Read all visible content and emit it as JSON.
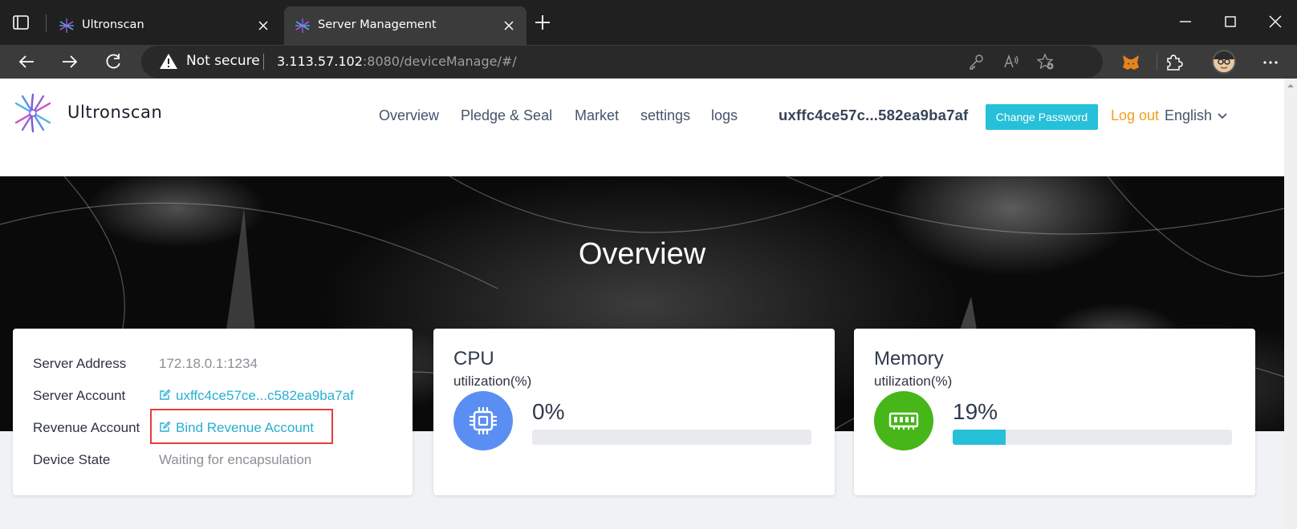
{
  "browser": {
    "tabs": [
      {
        "title": "Ultronscan",
        "active": false,
        "icon": "ultronscan-favicon"
      },
      {
        "title": "Server Management",
        "active": true,
        "icon": "ultronscan-favicon"
      }
    ],
    "address_bar": {
      "security_label": "Not secure",
      "url_host": "3.113.57.102",
      "url_rest": ":8080/deviceManage/#/"
    }
  },
  "header": {
    "brand": "Ultronscan",
    "nav": [
      "Overview",
      "Pledge & Seal",
      "Market",
      "settings",
      "logs"
    ],
    "account": "uxffc4ce57c...582ea9ba7af",
    "change_password": "Change Password",
    "logout": "Log out",
    "language": "English"
  },
  "hero": {
    "title": "Overview"
  },
  "server_info": {
    "rows": [
      {
        "label": "Server Address",
        "value": "172.18.0.1:1234"
      },
      {
        "label": "Server Account",
        "value": "uxffc4ce57ce...c582ea9ba7af"
      },
      {
        "label": "Revenue Account",
        "value": "Bind Revenue Account"
      },
      {
        "label": "Device State",
        "value": "Waiting for encapsulation"
      }
    ]
  },
  "cpu": {
    "title": "CPU",
    "subtitle": "utilization(%)",
    "value_label": "0%",
    "percent": 0,
    "icon": "cpu-chip-icon",
    "color": "#5b8ef2"
  },
  "memory": {
    "title": "Memory",
    "subtitle": "utilization(%)",
    "value_label": "19%",
    "percent": 19,
    "icon": "memory-module-icon",
    "color": "#46b618"
  },
  "colors": {
    "accent": "#26c0d8",
    "logout": "#f0a020",
    "highlight": "#e83c3c",
    "link": "#26b0d0"
  }
}
